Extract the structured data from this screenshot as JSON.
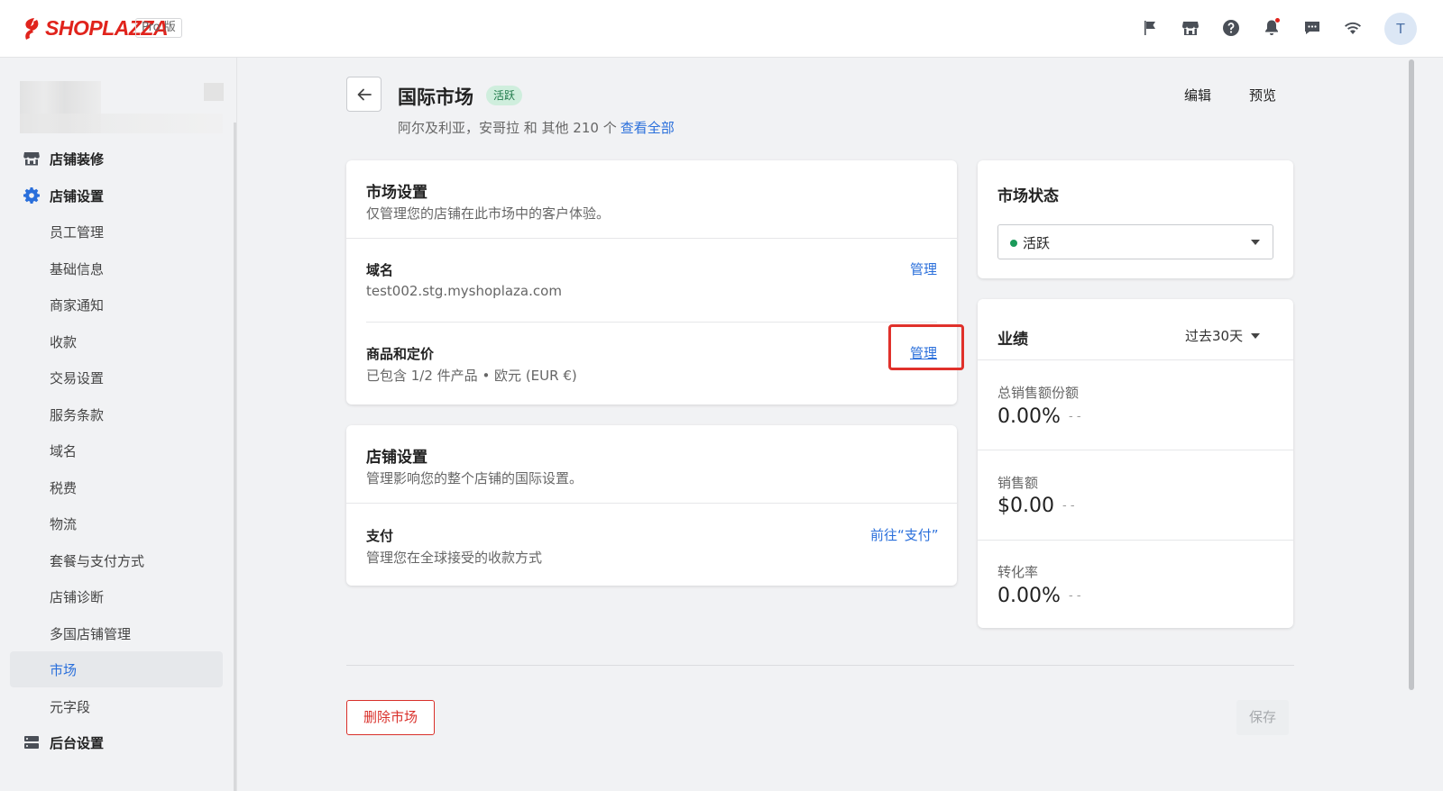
{
  "brand": {
    "logo_text": "SHOPLAZZA",
    "edition": "Pro 版",
    "accent_color": "#e0231c"
  },
  "topbar": {
    "icons": [
      "flag-icon",
      "store-icon",
      "help-icon",
      "bell-icon",
      "chat-icon",
      "wifi-icon"
    ],
    "avatar_initial": "T"
  },
  "sidebar": {
    "items": [
      {
        "label": "店铺装修",
        "level": "top",
        "icon": "storefront-icon"
      },
      {
        "label": "店铺设置",
        "level": "top",
        "icon": "gear-icon"
      },
      {
        "label": "员工管理",
        "level": "sub"
      },
      {
        "label": "基础信息",
        "level": "sub"
      },
      {
        "label": "商家通知",
        "level": "sub"
      },
      {
        "label": "收款",
        "level": "sub"
      },
      {
        "label": "交易设置",
        "level": "sub"
      },
      {
        "label": "服务条款",
        "level": "sub"
      },
      {
        "label": "域名",
        "level": "sub"
      },
      {
        "label": "税费",
        "level": "sub"
      },
      {
        "label": "物流",
        "level": "sub"
      },
      {
        "label": "套餐与支付方式",
        "level": "sub"
      },
      {
        "label": "店铺诊断",
        "level": "sub"
      },
      {
        "label": "多国店铺管理",
        "level": "sub"
      },
      {
        "label": "市场",
        "level": "sub",
        "active": true
      },
      {
        "label": "元字段",
        "level": "sub"
      },
      {
        "label": "后台设置",
        "level": "top",
        "icon": "server-icon"
      }
    ]
  },
  "header": {
    "title": "国际市场",
    "status": "活跃",
    "subtitle": "阿尔及利亚，安哥拉 和 其他 210 个",
    "view_all": "查看全部",
    "edit": "编辑",
    "preview": "预览"
  },
  "market_settings": {
    "title": "市场设置",
    "description": "仅管理您的店铺在此市场中的客户体验。",
    "domain": {
      "label": "域名",
      "value": "test002.stg.myshoplaza.com",
      "action": "管理"
    },
    "products": {
      "label": "商品和定价",
      "value": "已包含 1/2 件产品 • 欧元 (EUR €)",
      "action": "管理"
    }
  },
  "store_settings": {
    "title": "店铺设置",
    "description": "管理影响您的整个店铺的国际设置。",
    "payment": {
      "label": "支付",
      "value": "管理您在全球接受的收款方式",
      "action": "前往“支付”"
    }
  },
  "market_status": {
    "title": "市场状态",
    "selected": "活跃",
    "dot_color": "#1a9a5a"
  },
  "performance": {
    "title": "业绩",
    "period": "过去30天",
    "metrics": [
      {
        "label": "总销售额份额",
        "value": "0.00%",
        "trend": "- -"
      },
      {
        "label": "销售额",
        "value": "$0.00",
        "trend": "- -"
      },
      {
        "label": "转化率",
        "value": "0.00%",
        "trend": "- -"
      }
    ]
  },
  "footer": {
    "delete": "删除市场",
    "save": "保存"
  }
}
